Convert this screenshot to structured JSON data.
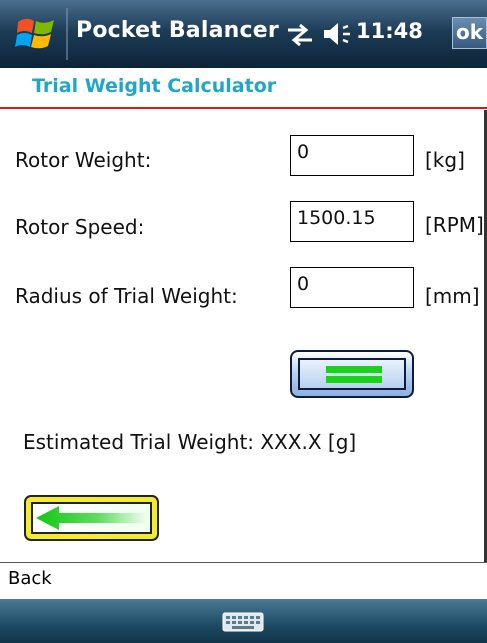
{
  "titlebar": {
    "app_name": "Pocket Balancer",
    "time": "11:48",
    "ok_label": "ok",
    "icons": [
      "windows-start-icon",
      "connectivity-icon",
      "volume-icon"
    ]
  },
  "page": {
    "title": "Trial Weight Calculator",
    "title_color": "#1fa7c9",
    "accent_line_color": "#d21b1b"
  },
  "form": {
    "rotor_weight": {
      "label": "Rotor Weight:",
      "value": "0",
      "unit": "[kg]"
    },
    "rotor_speed": {
      "label": "Rotor Speed:",
      "value": "1500.15",
      "unit": "[RPM]"
    },
    "trial_radius": {
      "label": "Radius of Trial Weight:",
      "value": "0",
      "unit": "[mm]"
    }
  },
  "calculate_button": {
    "icon": "equals-icon",
    "color": "#19d219"
  },
  "result": {
    "text": "Estimated Trial Weight: XXX.X [g]"
  },
  "back_arrow_button": {
    "icon": "arrow-left-icon",
    "fill": "#f2ec2c",
    "arrow_color": "#19d219"
  },
  "softkeys": {
    "left": "Back"
  },
  "taskbar": {
    "icon": "keyboard-icon"
  }
}
